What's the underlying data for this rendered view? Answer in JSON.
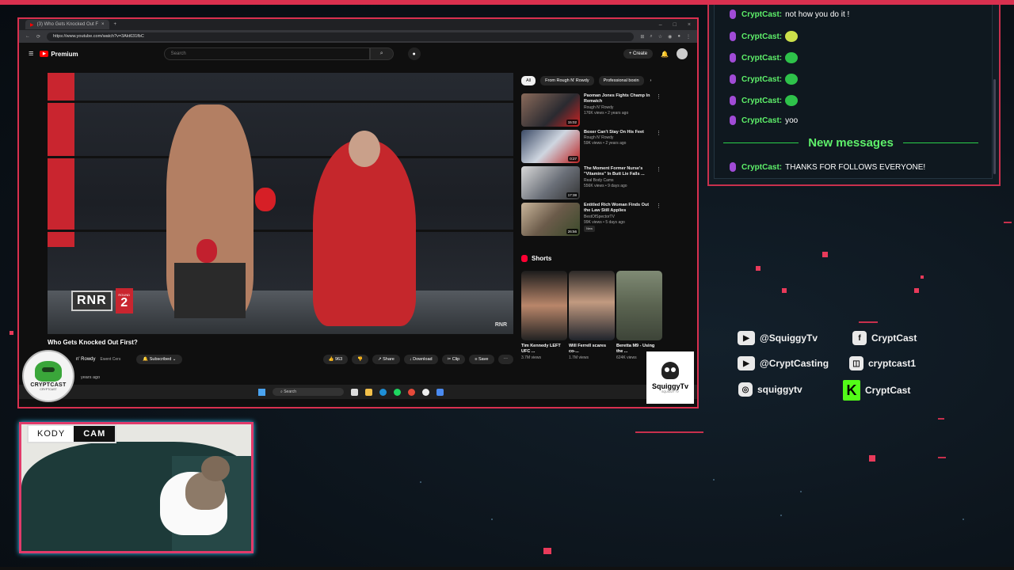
{
  "browser": {
    "tab_title": "(3) Who Gets Knocked Out F",
    "url": "https://www.youtube.com/watch?v=3Akt631fbC"
  },
  "youtube": {
    "logo_text": "Premium",
    "search_placeholder": "Search",
    "create_label": "Create",
    "video_title": "Who Gets Knocked Out First?",
    "video_overlay": {
      "brand": "RNR",
      "round_word": "ROUND",
      "round_number": "2",
      "watermark": "RNR"
    },
    "channel_name": "n' Rowdy",
    "channel_subs": "Ewent Cers",
    "subscribe_label": "Subscribed",
    "actions": {
      "likes": "963",
      "share": "Share",
      "download": "Download",
      "clip": "Clip",
      "save": "Save"
    },
    "upload_ago": "years ago",
    "chips": [
      "All",
      "From Rough N' Rowdy",
      "Professional boxin"
    ],
    "recommended": [
      {
        "title": "Paoman Jones Fights Champ In Rematch",
        "channel": "Rough N' Rowdy",
        "views": "176K views • 2 years ago",
        "duration": "15:02",
        "new": ""
      },
      {
        "title": "Boxer Can't Stay On His Feet",
        "channel": "Rough N' Rowdy",
        "views": "59K views • 2 years ago",
        "duration": "0:27",
        "new": ""
      },
      {
        "title": "The Moment Former Nurse's \"Vitamins\" In Butt Lie Falls ...",
        "channel": "Real Body Cams",
        "views": "556K views • 9 days ago",
        "duration": "17:38",
        "new": ""
      },
      {
        "title": "Entitled Rich Woman Finds Out the Law Still Applies",
        "channel": "BestOfSpectorTV",
        "views": "99K views • 5 days ago",
        "duration": "26:56",
        "new": "New"
      }
    ],
    "shorts_header": "Shorts",
    "shorts": [
      {
        "title": "Tim Kennedy LEFT UFC ...",
        "views": "3.7M views"
      },
      {
        "title": "Will Ferrell scares co-...",
        "views": "1.7M views"
      },
      {
        "title": "Beretta M9 - Using the ...",
        "views": "624K views"
      }
    ],
    "taskbar_search": "Search"
  },
  "overlay": {
    "crypt_logo": {
      "name": "CRYPTCAST",
      "sub": "CRYPTCAST"
    },
    "squiggy_logo": {
      "name": "SquiggyTv",
      "tag": "SQUIGGY TV"
    }
  },
  "chat": {
    "messages": [
      {
        "user": "CryptCast:",
        "text": "not how you do it !",
        "emote": ""
      },
      {
        "user": "CryptCast:",
        "text": "",
        "emote": "face"
      },
      {
        "user": "CryptCast:",
        "text": "",
        "emote": "green"
      },
      {
        "user": "CryptCast:",
        "text": "",
        "emote": "green"
      },
      {
        "user": "CryptCast:",
        "text": "",
        "emote": "green"
      },
      {
        "user": "CryptCast:",
        "text": "yoo",
        "emote": ""
      }
    ],
    "new_messages_label": "New messages",
    "latest": {
      "user": "CryptCast:",
      "text": "THANKS FOR FOLLOWS EVERYONE!"
    }
  },
  "socials": [
    {
      "icon": "youtube-icon",
      "handle": "@SquiggyTv"
    },
    {
      "icon": "facebook-icon",
      "handle": "CryptCast"
    },
    {
      "icon": "youtube-icon",
      "handle": "@CryptCasting"
    },
    {
      "icon": "twitch-icon",
      "handle": "cryptcast1"
    },
    {
      "icon": "instagram-icon",
      "handle": "squiggytv"
    },
    {
      "icon": "kick-icon",
      "handle": "CryptCast"
    }
  ],
  "webcam": {
    "label_left": "KODY",
    "label_right": "CAM"
  },
  "colors": {
    "accent": "#d9304f",
    "chat_user": "#5ef06a",
    "cam_glow": "#38c8ff"
  }
}
